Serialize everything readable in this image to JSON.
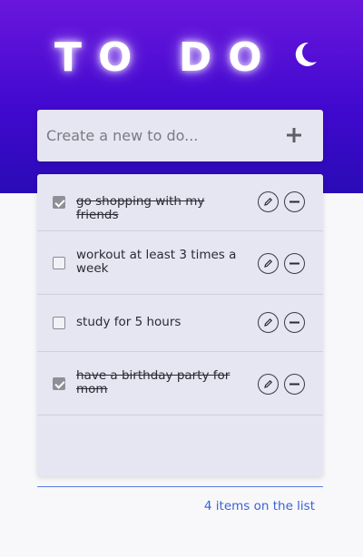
{
  "header": {
    "title": "TO DO",
    "theme_toggle_icon": "moon-icon",
    "colors": {
      "gradient_top": "#6a16dc",
      "gradient_bottom": "#2a0bb6",
      "accent": "#3b5fd8"
    }
  },
  "new_todo": {
    "placeholder": "Create a new to do...",
    "value": "",
    "add_icon": "plus-icon"
  },
  "todos": [
    {
      "text": "go shopping with my friends",
      "completed": true
    },
    {
      "text": "workout at least 3 times a week",
      "completed": false
    },
    {
      "text": "study for 5 hours",
      "completed": false
    },
    {
      "text": "have a birthday party for mom",
      "completed": true
    }
  ],
  "footer": {
    "count_text": "4 items on the list"
  }
}
